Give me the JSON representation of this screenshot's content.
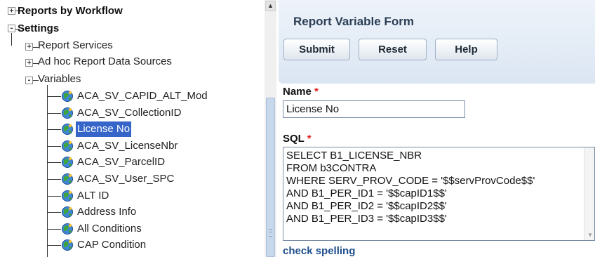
{
  "tree": {
    "top_items": [
      {
        "label": "Reports by Workflow",
        "toggle": "+"
      },
      {
        "label": "Settings",
        "toggle": "-"
      }
    ],
    "settings_children": [
      {
        "label": "Report Services",
        "toggle": "+"
      },
      {
        "label": "Ad hoc Report Data Sources",
        "toggle": "+"
      },
      {
        "label": "Variables",
        "toggle": "-"
      }
    ],
    "variables": [
      {
        "label": "ACA_SV_CAPID_ALT_Mod",
        "selected": false
      },
      {
        "label": "ACA_SV_CollectionID",
        "selected": false
      },
      {
        "label": "License No",
        "selected": true
      },
      {
        "label": "ACA_SV_LicenseNbr",
        "selected": false
      },
      {
        "label": "ACA_SV_ParcelID",
        "selected": false
      },
      {
        "label": "ACA_SV_User_SPC",
        "selected": false
      },
      {
        "label": "ALT ID",
        "selected": false
      },
      {
        "label": "Address Info",
        "selected": false
      },
      {
        "label": "All Conditions",
        "selected": false
      },
      {
        "label": "CAP Condition",
        "selected": false
      }
    ],
    "variable_icon": "globe-icon",
    "selection_color": "#3565c9"
  },
  "form": {
    "title": "Report Variable Form",
    "buttons": {
      "submit": "Submit",
      "reset": "Reset",
      "help": "Help"
    },
    "name_label": "Name",
    "required_mark": "*",
    "name_value": "License No",
    "sql_label": "SQL",
    "sql_lines": [
      "SELECT B1_LICENSE_NBR",
      "FROM b3CONTRA",
      "WHERE SERV_PROV_CODE  = '$$servProvCode$$'",
      "AND B1_PER_ID1 = '$$capID1$$'",
      "AND B1_PER_ID2 = '$$capID2$$'",
      "AND B1_PER_ID3 = '$$capID3$$'"
    ],
    "check_spelling": "check spelling",
    "required_color": "#d22222",
    "header_color": "#dbe6f3"
  }
}
